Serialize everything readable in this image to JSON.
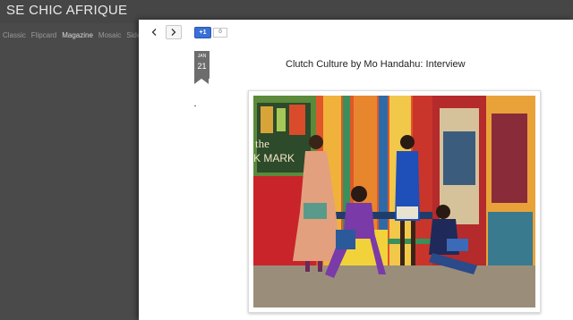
{
  "blog": {
    "title": "SE CHIC AFRIQUE"
  },
  "nav": {
    "items": [
      "Classic",
      "Flipcard",
      "Magazine",
      "Mosaic",
      "Sidebar"
    ],
    "active": "Magazine"
  },
  "toolbar": {
    "prev_icon": "chevron-left",
    "next_icon": "chevron-right",
    "plusone_label": "+1",
    "plusone_count": "0"
  },
  "post": {
    "date_month": "JAN",
    "date_day": "21",
    "title": "Clutch Culture by Mo Handahu: Interview",
    "image_alt": "Four women posing with clutches in front of a colorful patterned storefront"
  },
  "colors": {
    "overlay": "#4a4a4a",
    "panel": "#ffffff",
    "date_flag": "#6d6d6d",
    "plusone": "#3a6fd8"
  }
}
